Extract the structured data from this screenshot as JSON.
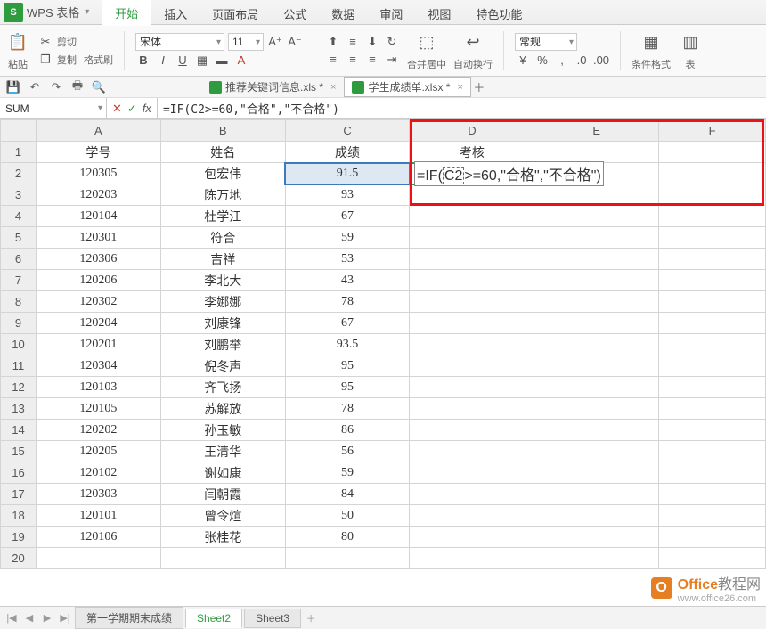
{
  "app": {
    "logo": "S",
    "title": "WPS 表格"
  },
  "menu_tabs": [
    "开始",
    "插入",
    "页面布局",
    "公式",
    "数据",
    "审阅",
    "视图",
    "特色功能"
  ],
  "active_menu_tab": 0,
  "ribbon": {
    "paste": "粘贴",
    "cut": "剪切",
    "copy": "复制",
    "format_painter": "格式刷",
    "font_name": "宋体",
    "font_size": "11",
    "bold": "B",
    "italic": "I",
    "underline": "U",
    "merge_center": "合并居中",
    "wrap_text": "自动换行",
    "number_format": "常规",
    "cond_format": "条件格式",
    "table_style": "表"
  },
  "doc_tabs": [
    {
      "label": "推荐关键词信息.xls *",
      "active": false
    },
    {
      "label": "学生成绩单.xlsx *",
      "active": true
    }
  ],
  "name_box": "SUM",
  "formula": "=IF(C2>=60,\"合格\",\"不合格\")",
  "columns": [
    "A",
    "B",
    "C",
    "D",
    "E",
    "F"
  ],
  "headers": {
    "A": "学号",
    "B": "姓名",
    "C": "成绩",
    "D": "考核"
  },
  "formula_display": {
    "prefix": "=IF(",
    "ref": "C2",
    "suffix": ">=60,\"合格\",\"不合格\")"
  },
  "rows": [
    {
      "A": "120305",
      "B": "包宏伟",
      "C": "91.5"
    },
    {
      "A": "120203",
      "B": "陈万地",
      "C": "93"
    },
    {
      "A": "120104",
      "B": "杜学江",
      "C": "67"
    },
    {
      "A": "120301",
      "B": "符合",
      "C": "59"
    },
    {
      "A": "120306",
      "B": "吉祥",
      "C": "53"
    },
    {
      "A": "120206",
      "B": "李北大",
      "C": "43"
    },
    {
      "A": "120302",
      "B": "李娜娜",
      "C": "78"
    },
    {
      "A": "120204",
      "B": "刘康锋",
      "C": "67"
    },
    {
      "A": "120201",
      "B": "刘鹏举",
      "C": "93.5"
    },
    {
      "A": "120304",
      "B": "倪冬声",
      "C": "95"
    },
    {
      "A": "120103",
      "B": "齐飞扬",
      "C": "95"
    },
    {
      "A": "120105",
      "B": "苏解放",
      "C": "78"
    },
    {
      "A": "120202",
      "B": "孙玉敏",
      "C": "86"
    },
    {
      "A": "120205",
      "B": "王清华",
      "C": "56"
    },
    {
      "A": "120102",
      "B": "谢如康",
      "C": "59"
    },
    {
      "A": "120303",
      "B": "闫朝霞",
      "C": "84"
    },
    {
      "A": "120101",
      "B": "曾令煊",
      "C": "50"
    },
    {
      "A": "120106",
      "B": "张桂花",
      "C": "80"
    }
  ],
  "sheet_tabs": [
    "第一学期期末成绩",
    "Sheet2",
    "Sheet3"
  ],
  "active_sheet_tab": 1,
  "watermark": {
    "brand": "Office",
    "suffix": "教程网",
    "url": "www.office26.com"
  }
}
